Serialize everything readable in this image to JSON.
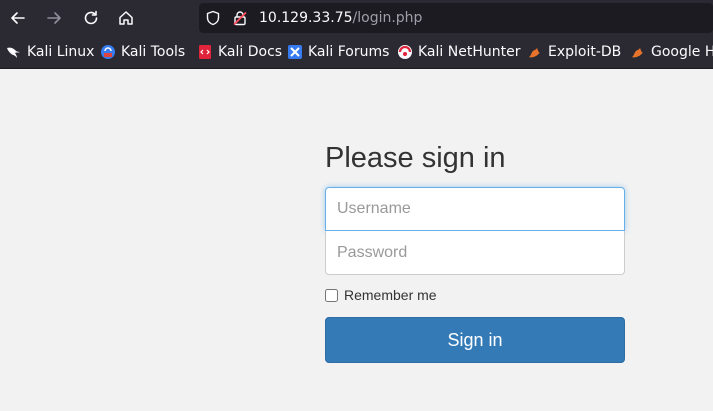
{
  "browser": {
    "url_host": "10.129.33.75",
    "url_path": "/login.php",
    "icons": [
      "back-icon",
      "forward-icon",
      "reload-icon",
      "home-icon",
      "shield-icon",
      "insecure-lock-icon"
    ]
  },
  "bookmarks": [
    {
      "label": "Kali Linux",
      "icon": "kali-dragon-icon"
    },
    {
      "label": "Kali Tools",
      "icon": "kali-tools-icon"
    },
    {
      "label": "Kali Docs",
      "icon": "kali-docs-icon"
    },
    {
      "label": "Kali Forums",
      "icon": "kali-forums-icon"
    },
    {
      "label": "Kali NetHunter",
      "icon": "nethunter-icon"
    },
    {
      "label": "Exploit-DB",
      "icon": "exploit-db-icon"
    },
    {
      "label": "Google Ha",
      "icon": "ghdb-icon"
    }
  ],
  "login": {
    "heading": "Please sign in",
    "username_placeholder": "Username",
    "password_placeholder": "Password",
    "remember_label": "Remember me",
    "submit_label": "Sign in"
  },
  "colors": {
    "accent": "#337ab7",
    "focus": "#66afe9",
    "browser_chrome": "#2b2a33"
  }
}
